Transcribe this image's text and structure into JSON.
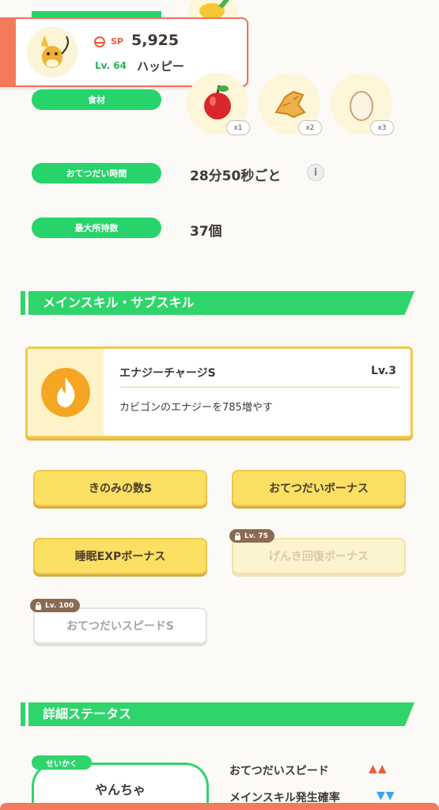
{
  "header_card": {
    "sp_label": "SP",
    "sp_value": "5,925",
    "level": "Lv. 64",
    "nickname": "ハッピー"
  },
  "ingredients": {
    "label": "食材",
    "items": [
      {
        "icon": "apple-icon",
        "count": "x1"
      },
      {
        "icon": "ginger-icon",
        "count": "x2"
      },
      {
        "icon": "egg-icon",
        "count": "x3"
      }
    ]
  },
  "help_time": {
    "label": "おてつだい時間",
    "value": "28分50秒ごと",
    "info_icon": "i"
  },
  "max_carry": {
    "label": "最大所持数",
    "value": "37個"
  },
  "skills_section": {
    "title": "メインスキル・サブスキル"
  },
  "main_skill": {
    "name": "エナジーチャージS",
    "level": "Lv.3",
    "description": "カビゴンのエナジーを785増やす",
    "icon": "flame-icon"
  },
  "sub_skills": [
    {
      "label": "きのみの数S",
      "state": "active"
    },
    {
      "label": "おてつだいボーナス",
      "state": "active"
    },
    {
      "label": "睡眠EXPボーナス",
      "state": "active"
    },
    {
      "label": "げんき回復ボーナス",
      "state": "faded",
      "lock_level": "Lv. 75"
    },
    {
      "label": "おてつだいスピードS",
      "state": "locked",
      "lock_level": "Lv. 100"
    }
  ],
  "detail_section": {
    "title": "詳細ステータス"
  },
  "nature": {
    "tag": "せいかく",
    "value": "やんちゃ",
    "stats": [
      {
        "label": "おてつだいスピード",
        "arrows": "▲▲"
      },
      {
        "label": "メインスキル発生確率",
        "arrows": "▼▼"
      }
    ]
  },
  "colors": {
    "accent_green": "#2fd56b",
    "highlight_yellow": "#fbe064",
    "up_red": "#ee5a3c",
    "down_blue": "#3aa5ec"
  }
}
